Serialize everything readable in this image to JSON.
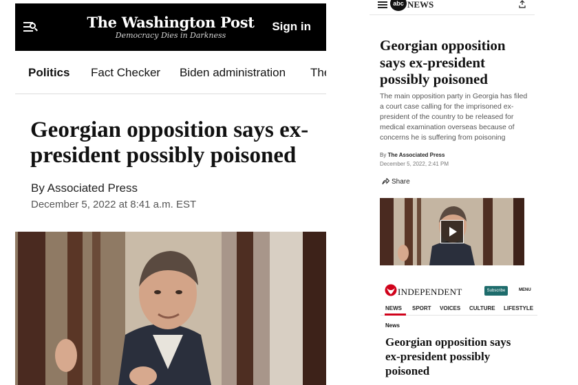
{
  "wapo": {
    "logo": "The Washington Post",
    "tagline": "Democracy Dies in Darkness",
    "sign_in": "Sign in",
    "nav": [
      "Politics",
      "Fact Checker",
      "Biden administration",
      "The"
    ],
    "headline": "Georgian opposition says ex-president possibly poisoned",
    "byline": "By Associated Press",
    "date": "December 5, 2022 at 8:41 a.m. EST",
    "icons": {
      "menu": "menu-search-icon"
    }
  },
  "abc": {
    "logo_circle": "abc",
    "logo_text": "NEWS",
    "headline": "Georgian opposition says ex-president possibly poisoned",
    "summary": "The main opposition party in Georgia has filed a court case calling for the imprisoned ex-president of the country to be released for medical examination overseas because of concerns he is suffering from poisoning",
    "by_prefix": "By",
    "author": "The Associated Press",
    "date": "December 5, 2022, 2:41 PM",
    "share": "Share",
    "icons": {
      "menu": "hamburger-icon",
      "share": "share-icon",
      "play": "play-icon"
    }
  },
  "independent": {
    "logo": "INDEPENDENT",
    "subscribe": "Subscribe",
    "menu": "MENU",
    "nav": [
      "NEWS",
      "SPORT",
      "VOICES",
      "CULTURE",
      "LIFESTYLE"
    ],
    "active_nav": "NEWS",
    "section": "News",
    "headline": "Georgian opposition says ex-president possibly poisoned",
    "accent_color": "#d0021b",
    "subscribe_color": "#1e6c6c"
  }
}
